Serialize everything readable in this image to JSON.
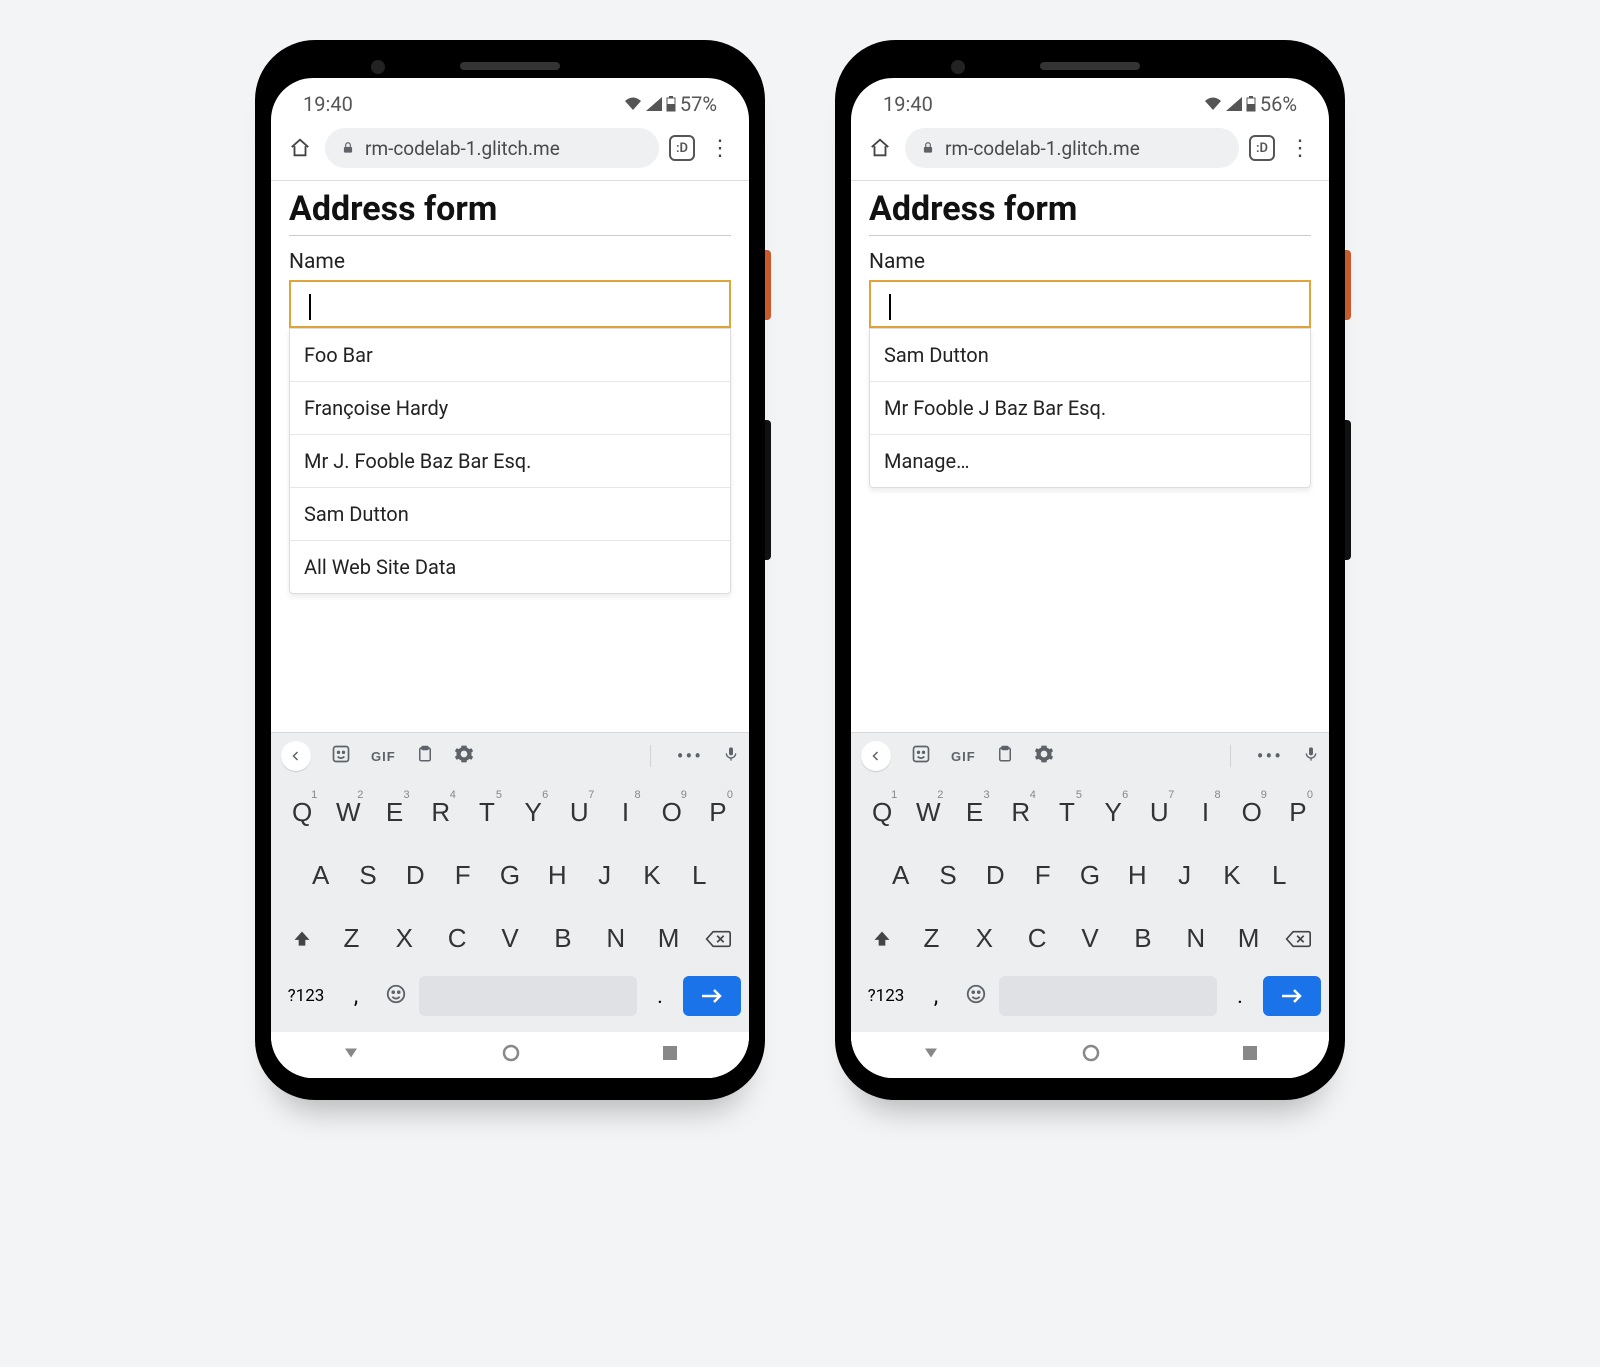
{
  "phones": [
    {
      "status": {
        "time": "19:40",
        "battery": "57%"
      },
      "omnibox": {
        "url": "rm-codelab-1.glitch.me"
      },
      "page": {
        "title": "Address form",
        "name_label": "Name",
        "name_value": "",
        "suggestions": [
          "Foo Bar",
          "Françoise Hardy",
          "Mr J. Fooble Baz Bar Esq.",
          "Sam Dutton",
          "All Web Site Data"
        ]
      }
    },
    {
      "status": {
        "time": "19:40",
        "battery": "56%"
      },
      "omnibox": {
        "url": "rm-codelab-1.glitch.me"
      },
      "page": {
        "title": "Address form",
        "name_label": "Name",
        "name_value": "",
        "suggestions": [
          "Sam Dutton",
          "Mr Fooble J Baz Bar Esq.",
          "Manage…"
        ]
      }
    }
  ],
  "keyboard": {
    "toolbar_gif": "GIF",
    "sym_label": "?123",
    "row1": [
      "Q",
      "W",
      "E",
      "R",
      "T",
      "Y",
      "U",
      "I",
      "O",
      "P"
    ],
    "row1_super": [
      "1",
      "2",
      "3",
      "4",
      "5",
      "6",
      "7",
      "8",
      "9",
      "0"
    ],
    "row2": [
      "A",
      "S",
      "D",
      "F",
      "G",
      "H",
      "J",
      "K",
      "L"
    ],
    "row3": [
      "Z",
      "X",
      "C",
      "V",
      "B",
      "N",
      "M"
    ],
    "comma": ",",
    "period": "."
  }
}
